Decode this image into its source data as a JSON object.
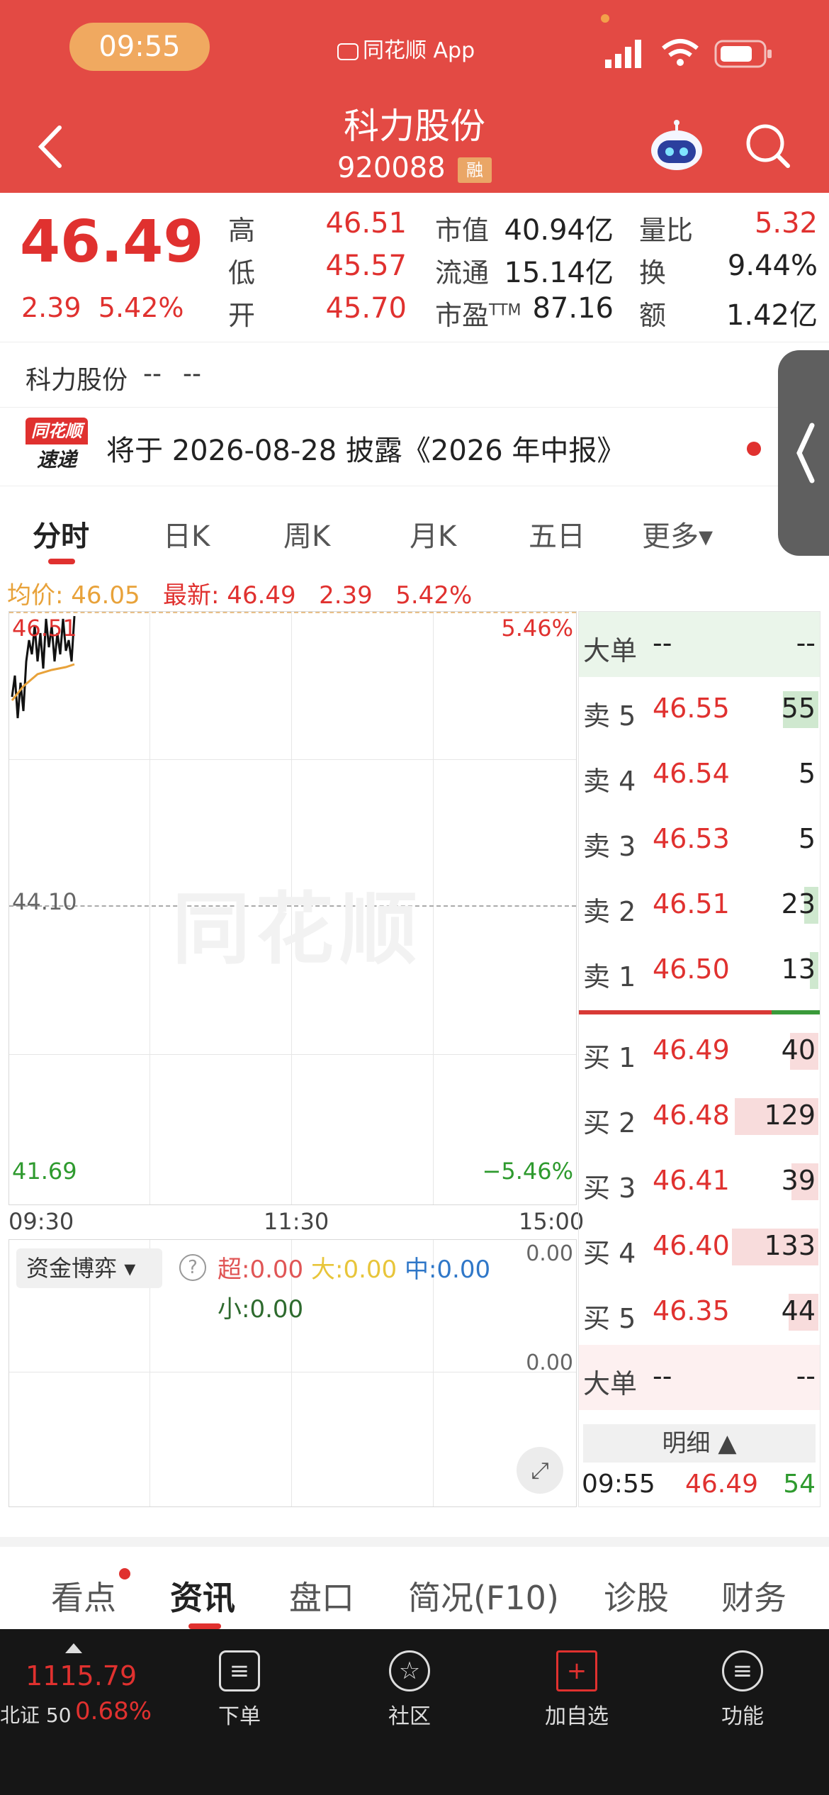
{
  "status_bar": {
    "time": "09:55",
    "app_label": "同花顺 App"
  },
  "header": {
    "title": "科力股份",
    "code": "920088",
    "badge": "融"
  },
  "quote": {
    "price": "46.49",
    "change": "2.39",
    "change_pct": "5.42%",
    "high_label": "高",
    "high": "46.51",
    "low_label": "低",
    "low": "45.57",
    "open_label": "开",
    "open": "45.70",
    "mktcap_label": "市值",
    "mktcap": "40.94亿",
    "float_label": "流通",
    "float": "15.14亿",
    "pe_label": "市盈",
    "pe_sup": "TTM",
    "pe": "87.16",
    "volratio_label": "量比",
    "volratio": "5.32",
    "turnover_label": "换",
    "turnover": "9.44%",
    "amount_label": "额",
    "amount": "1.42亿"
  },
  "name_row": {
    "name": "科力股份",
    "v1": "--",
    "v2": "--"
  },
  "news": {
    "logo_top": "同花顺",
    "logo_bottom": "速递",
    "text": "将于 2026-08-28 披露《2026 年中报》"
  },
  "tabs": [
    "分时",
    "日K",
    "周K",
    "月K",
    "五日",
    "更多▾"
  ],
  "avg_line": {
    "avg_label": "均价: 46.05",
    "latest_label": "最新: 46.49",
    "chg": "2.39",
    "pct": "5.42%"
  },
  "chart": {
    "top_left": "46.51",
    "top_right": "5.46%",
    "mid": "44.10",
    "bottom_left": "41.69",
    "bottom_right": "−5.46%",
    "x_labels": [
      "09:30",
      "11:30",
      "15:00"
    ],
    "watermark": "同花顺"
  },
  "fund": {
    "select_label": "资金博弈",
    "super": "超:0.00",
    "big": "大:0.00",
    "mid": "中:0.00",
    "small": "小:0.00",
    "right_top": "0.00",
    "right_mid": "0.00"
  },
  "book": {
    "big_label": "大单",
    "big_v1": "--",
    "big_v2": "--",
    "asks": [
      {
        "label": "卖 5",
        "price": "46.55",
        "vol": "55"
      },
      {
        "label": "卖 4",
        "price": "46.54",
        "vol": "5"
      },
      {
        "label": "卖 3",
        "price": "46.53",
        "vol": "5"
      },
      {
        "label": "卖 2",
        "price": "46.51",
        "vol": "23"
      },
      {
        "label": "卖 1",
        "price": "46.50",
        "vol": "13"
      }
    ],
    "bids": [
      {
        "label": "买 1",
        "price": "46.49",
        "vol": "40"
      },
      {
        "label": "买 2",
        "price": "46.48",
        "vol": "129"
      },
      {
        "label": "买 3",
        "price": "46.41",
        "vol": "39"
      },
      {
        "label": "买 4",
        "price": "46.40",
        "vol": "133"
      },
      {
        "label": "买 5",
        "price": "46.35",
        "vol": "44"
      }
    ],
    "big2_label": "大单",
    "big2_v1": "--",
    "big2_v2": "--",
    "detail_label": "明细 ▲",
    "trade_time": "09:55",
    "trade_price": "46.49",
    "trade_vol": "54"
  },
  "section_tabs": [
    "看点",
    "资讯",
    "盘口",
    "简况(F10)",
    "诊股",
    "财务"
  ],
  "bottom_bar": {
    "index_value": "1115.79",
    "index_name": "北证 50",
    "index_pct": "0.68%",
    "items": [
      "下单",
      "社区",
      "加自选",
      "功能"
    ]
  }
}
